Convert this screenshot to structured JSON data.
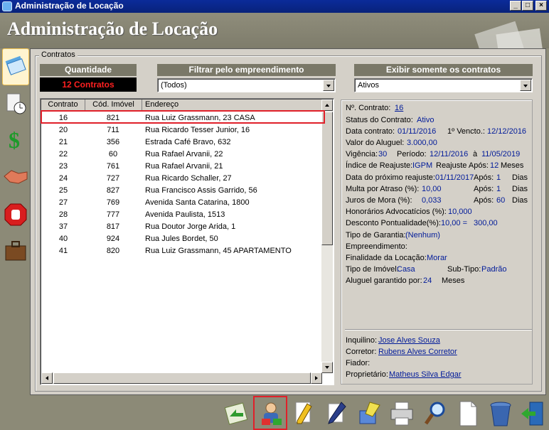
{
  "window": {
    "title": "Administração de Locação",
    "buttons": [
      "_",
      "□",
      "×"
    ]
  },
  "header": {
    "title": "Administração de Locação"
  },
  "sidebar": {
    "items": [
      {
        "name": "contracts-icon",
        "active": true
      },
      {
        "name": "schedule-icon"
      },
      {
        "name": "dollar-icon"
      },
      {
        "name": "handshake-icon"
      },
      {
        "name": "stop-icon"
      },
      {
        "name": "briefcase-icon"
      }
    ]
  },
  "contracts": {
    "group_label": "Contratos",
    "quantity_header": "Quantidade",
    "quantity_value": "12 Contratos",
    "filter_header": "Filtrar pelo empreendimento",
    "filter_value": "(Todos)",
    "show_header": "Exibir somente os contratos",
    "show_value": "Ativos",
    "columns": [
      "Contrato",
      "Cód. Imóvel",
      "Endereço"
    ],
    "rows": [
      [
        "16",
        "821",
        "Rua Luiz Grassmann, 23 CASA"
      ],
      [
        "20",
        "711",
        "Rua Ricardo Tesser Junior, 16"
      ],
      [
        "21",
        "356",
        "Estrada Café Bravo, 632"
      ],
      [
        "22",
        "60",
        "Rua Rafael Arvanii, 22"
      ],
      [
        "23",
        "761",
        "Rua Rafael Arvanii, 21"
      ],
      [
        "24",
        "727",
        "Rua Ricardo Schaller, 27"
      ],
      [
        "25",
        "827",
        "Rua Francisco Assis Garrido, 56"
      ],
      [
        "27",
        "769",
        "Avenida Santa Catarina, 1800"
      ],
      [
        "28",
        "777",
        "Avenida Paulista, 1513"
      ],
      [
        "37",
        "817",
        "Rua Doutor Jorge Arida, 1"
      ],
      [
        "40",
        "924",
        "Rua Jules Bordet, 50"
      ],
      [
        "41",
        "820",
        "Rua Luiz Grassmann, 45 APARTAMENTO"
      ]
    ],
    "selected_row": "16"
  },
  "detail": {
    "contract_label": "Nº. Contrato:",
    "contract_value": "16",
    "status_label": "Status do Contrato:",
    "status_value": "Ativo",
    "date_label": "Data contrato:",
    "date_value": "01/11/2016",
    "first_due_label": "1º Vencto.:",
    "first_due_value": "12/12/2016",
    "rent_label": "Valor do Aluguel:",
    "rent_value": "3.000,00",
    "validity_label": "Vigência:",
    "validity_value": "30",
    "period_label": "Período:",
    "period_start": "12/11/2016",
    "period_sep": "à",
    "period_end": "11/05/2019",
    "index_label": "Índice de Reajuste:",
    "index_value": "IGPM",
    "readjust_after_label": "Reajuste Após:",
    "readjust_after_value": "12",
    "months_label": "Meses",
    "next_readjust_label": "Data do próximo reajuste:",
    "next_readjust_value": "01/11/2017",
    "after_label": "Após:",
    "days_label": "Dias",
    "next_readjust_after": "1",
    "late_fee_label": "Multa por Atraso (%):",
    "late_fee_value": "10,00",
    "late_fee_after": "1",
    "interest_label": "Juros de Mora (%):",
    "interest_value": "0,033",
    "interest_after": "60",
    "fees_label": "Honorários Advocatícios (%):",
    "fees_value": "10,000",
    "discount_label": "Desconto Pontualidade(%):",
    "discount_value": "10,00 =",
    "discount_amount": "300,00",
    "guarantee_label": "Tipo de Garantia:",
    "guarantee_value": "(Nenhum)",
    "development_label": "Empreendimento:",
    "purpose_label": "Finalidade da Locação:",
    "purpose_value": "Morar",
    "property_type_label": "Tipo de Imóvel:",
    "property_type_value": "Casa",
    "subtype_label": "Sub-Tipo:",
    "subtype_value": "Padrão",
    "guaranteed_label": "Aluguel garantido por:",
    "guaranteed_value": "24",
    "guaranteed_unit": "Meses",
    "tenant_label": "Inquilino:",
    "tenant_value": "Jose Alves Souza",
    "broker_label": "Corretor:",
    "broker_value": "Rubens Alves Corretor",
    "guarantor_label": "Fiador:",
    "owner_label": "Proprietário:",
    "owner_value": "Matheus Silva Edgar"
  },
  "toolbar": {
    "items": [
      "transfer-icon",
      "person-edit-icon",
      "pencil-icon",
      "pen-icon",
      "brush-icon",
      "printer-icon",
      "magnifier-icon",
      "document-icon",
      "trash-icon",
      "exit-icon"
    ],
    "selected": "person-edit-icon"
  }
}
